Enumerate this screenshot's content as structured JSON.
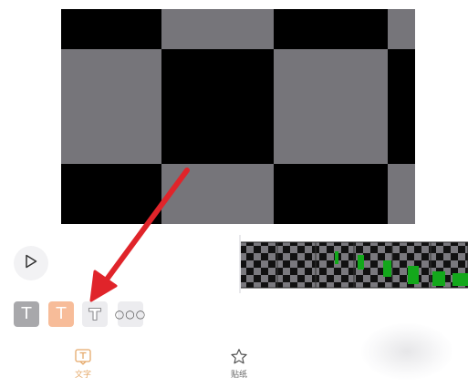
{
  "toolbar": {
    "play_label": "play",
    "chip_text_plain": "T",
    "chip_text_filled": "T",
    "chip_text_outline": "T",
    "chip_more": "○○○"
  },
  "tabs": [
    {
      "label": "文字",
      "icon": "text-icon",
      "active": true
    },
    {
      "label": "贴纸",
      "icon": "star-icon",
      "active": false
    }
  ],
  "colors": {
    "accent": "#e5a96a",
    "arrow": "#e0242a",
    "checker_dark": "#000000",
    "checker_gray": "#76757a",
    "timeline_green": "#13a81b"
  }
}
